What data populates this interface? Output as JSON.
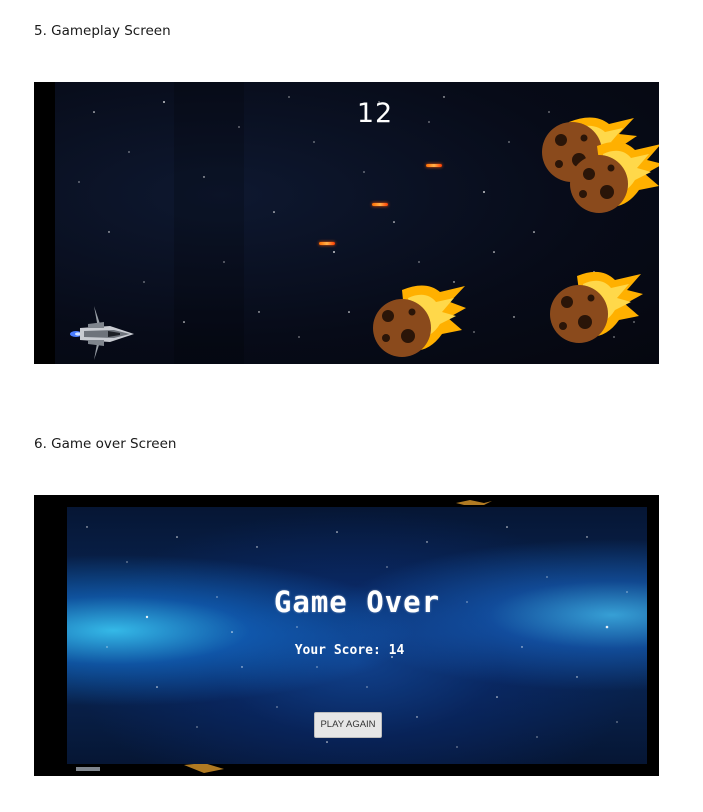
{
  "document": {
    "sections": [
      {
        "heading": "5. Gameplay Screen"
      },
      {
        "heading": "6. Game over Screen"
      }
    ]
  },
  "gameplay": {
    "score": "12",
    "colors": {
      "laser": "#ff6a00",
      "asteroid": "#8a4a1c",
      "flame": "#ffb000"
    },
    "icons": [
      "spaceship-icon",
      "asteroid-icon",
      "laser-icon"
    ]
  },
  "gameover": {
    "title": "Game Over",
    "score_text": "Your Score: 14",
    "play_again_label": "PLAY AGAIN"
  }
}
